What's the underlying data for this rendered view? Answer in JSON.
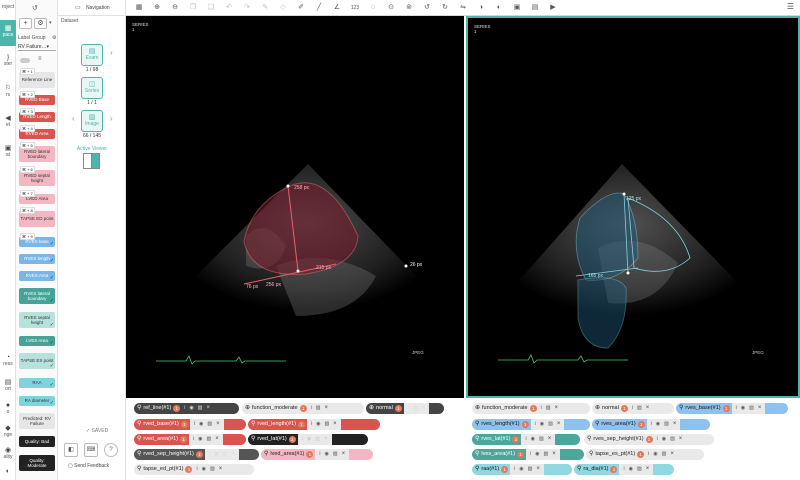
{
  "leftbar": {
    "items": [
      {
        "label": "roject",
        "icon": ""
      },
      {
        "label": "pace",
        "icon": "▦"
      },
      {
        "label": "ster",
        "icon": "}"
      },
      {
        "label": "rs",
        "icon": "⚐"
      },
      {
        "label": "et",
        "icon": "◀"
      },
      {
        "label": "at",
        "icon": "▣"
      },
      {
        "label": "ress",
        "icon": "◔"
      },
      {
        "label": "ort",
        "icon": "▤"
      },
      {
        "label": "o",
        "icon": "●"
      },
      {
        "label": "nge",
        "icon": "◆"
      },
      {
        "label": "ality",
        "icon": "◉"
      },
      {
        "label": "",
        "icon": "◐"
      }
    ]
  },
  "labels": {
    "group_label": "Label Group",
    "group_value": "RV Failure",
    "items": [
      {
        "text": "Reference Line",
        "shortcut": "⌘ + 1",
        "style": "l-grey"
      },
      {
        "text": "RVED Base",
        "shortcut": "⌘ + 2",
        "style": "l-red"
      },
      {
        "text": "RVED Length",
        "shortcut": "⌘ + 3",
        "style": "l-red"
      },
      {
        "text": "RVED Area",
        "shortcut": "⌘ + 4",
        "style": "l-red"
      },
      {
        "text": "RVED lateral boundary",
        "shortcut": "⌘ + 5",
        "style": "l-pink"
      },
      {
        "text": "RVED septal height",
        "shortcut": "⌘ + 6",
        "style": "l-pink"
      },
      {
        "text": "LVED Area",
        "shortcut": "⌘ + 7",
        "style": "l-pink"
      },
      {
        "text": "TAPSE ED point",
        "shortcut": "⌘ + 8",
        "style": "l-pink"
      },
      {
        "text": "RVES base",
        "shortcut": "⌘ + 9",
        "style": "l-blue"
      },
      {
        "text": "RVES length",
        "shortcut": "",
        "style": "l-blue"
      },
      {
        "text": "RVES Area",
        "shortcut": "",
        "style": "l-blue"
      },
      {
        "text": "RVES lateral boundary",
        "shortcut": "",
        "style": "l-teal"
      },
      {
        "text": "RVES septal height",
        "shortcut": "",
        "style": "l-mint"
      },
      {
        "text": "LVES Area",
        "shortcut": "",
        "style": "l-teal"
      },
      {
        "text": "TAPSE ES point",
        "shortcut": "",
        "style": "l-mint"
      },
      {
        "text": "RAA",
        "shortcut": "",
        "style": "l-cyan"
      },
      {
        "text": "RA diameter",
        "shortcut": "",
        "style": "l-cyan"
      },
      {
        "text": "Predicted: RV Failure",
        "shortcut": "",
        "style": "l-grey"
      },
      {
        "text": "Quality: Bad",
        "shortcut": "",
        "style": "l-dark"
      },
      {
        "text": "Quality: Moderate",
        "shortcut": "",
        "style": "l-dark"
      }
    ]
  },
  "navigation": {
    "title": "Navigation",
    "dataset": "Dataset",
    "exam_label": "Exam",
    "exam_count": "1 / 98",
    "series_label": "Series",
    "series_count": "1 / 1",
    "image_label": "Image",
    "image_count": "66 / 145",
    "active_viewer": "Active Viewer",
    "saved": "SAVED",
    "feedback": "Send Feedback"
  },
  "toolbar": {
    "icons": [
      "grid-icon",
      "zoom-in-icon",
      "zoom-out-icon",
      "copy-icon",
      "copy2-icon",
      "undo-icon",
      "redo-icon",
      "paint-icon",
      "eraser-icon",
      "pen-icon",
      "line-icon",
      "angle-icon",
      "number-icon",
      "lasso-icon",
      "zoom-fit-icon",
      "zoom-reset-icon",
      "rotate-left-icon",
      "rotate-right-icon",
      "flip-icon",
      "contrast-icon",
      "invert-icon",
      "save-icon",
      "layers-icon",
      "play-icon",
      "stack-icon"
    ],
    "number_text": "123"
  },
  "viewer1": {
    "series": "SERIES",
    "series_no": "1",
    "jpeg": "JPEG",
    "m1": "258 px",
    "m2": "215 px",
    "m3": "256 px",
    "m4": "76 px",
    "m5": "26 px"
  },
  "viewer2": {
    "series": "SERIES",
    "series_no": "1",
    "jpeg": "JPEG",
    "m1": "125 px",
    "m2": "165 px"
  },
  "tags1": [
    {
      "text": "ref_line(#1)",
      "style": "t-dark"
    },
    {
      "text": "function_moderate",
      "style": "t-light"
    },
    {
      "text": "normal",
      "style": "t-dark"
    },
    {
      "text": "rved_base(#1)",
      "style": "t-red"
    },
    {
      "text": "rved_length(#1)",
      "style": "t-red"
    },
    {
      "text": "rved_area(#1)",
      "style": "t-red"
    },
    {
      "text": "rved_lat(#1)",
      "style": "t-black"
    },
    {
      "text": "rved_sep_height(#1)",
      "style": "t-grey2"
    },
    {
      "text": "lved_area(#1)",
      "style": "t-pink"
    },
    {
      "text": "tapse_ed_pt(#1)",
      "style": "t-light"
    }
  ],
  "tags2": [
    {
      "text": "function_moderate",
      "style": "t-light"
    },
    {
      "text": "normal",
      "style": "t-light"
    },
    {
      "text": "rves_base(#1)",
      "style": "t-blue"
    },
    {
      "text": "rves_length(#1)",
      "style": "t-blue"
    },
    {
      "text": "rves_area(#1)",
      "style": "t-blue"
    },
    {
      "text": "rves_lat(#1)",
      "style": "t-teal"
    },
    {
      "text": "rves_sep_height(#1)",
      "style": "t-light"
    },
    {
      "text": "lves_area(#1)",
      "style": "t-teal"
    },
    {
      "text": "tapse_es_pt(#1)",
      "style": "t-light"
    },
    {
      "text": "raa(#1)",
      "style": "t-cyan"
    },
    {
      "text": "ra_dia(#1)",
      "style": "t-cyan"
    }
  ]
}
